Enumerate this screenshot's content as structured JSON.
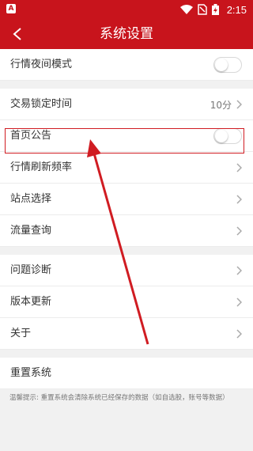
{
  "status_bar": {
    "time": "2:15",
    "app_badge": "A"
  },
  "nav": {
    "title": "系统设置"
  },
  "groups": [
    [
      {
        "label": "行情夜间模式",
        "type": "toggle",
        "on": false
      }
    ],
    [
      {
        "label": "交易锁定时间",
        "type": "value",
        "value": "10分"
      },
      {
        "label": "首页公告",
        "type": "toggle",
        "on": false,
        "highlighted": true
      },
      {
        "label": "行情刷新频率",
        "type": "chevron"
      },
      {
        "label": "站点选择",
        "type": "chevron"
      },
      {
        "label": "流量查询",
        "type": "chevron"
      }
    ],
    [
      {
        "label": "问题诊断",
        "type": "chevron"
      },
      {
        "label": "版本更新",
        "type": "chevron"
      },
      {
        "label": "关于",
        "type": "chevron"
      }
    ],
    [
      {
        "label": "重置系统",
        "type": "plain"
      }
    ]
  ],
  "hint": "温馨提示: 重置系统会清除系统已经保存的数据（如自选股，账号等数据）",
  "colors": {
    "brand": "#c8141c",
    "annotation": "#d01c22"
  }
}
